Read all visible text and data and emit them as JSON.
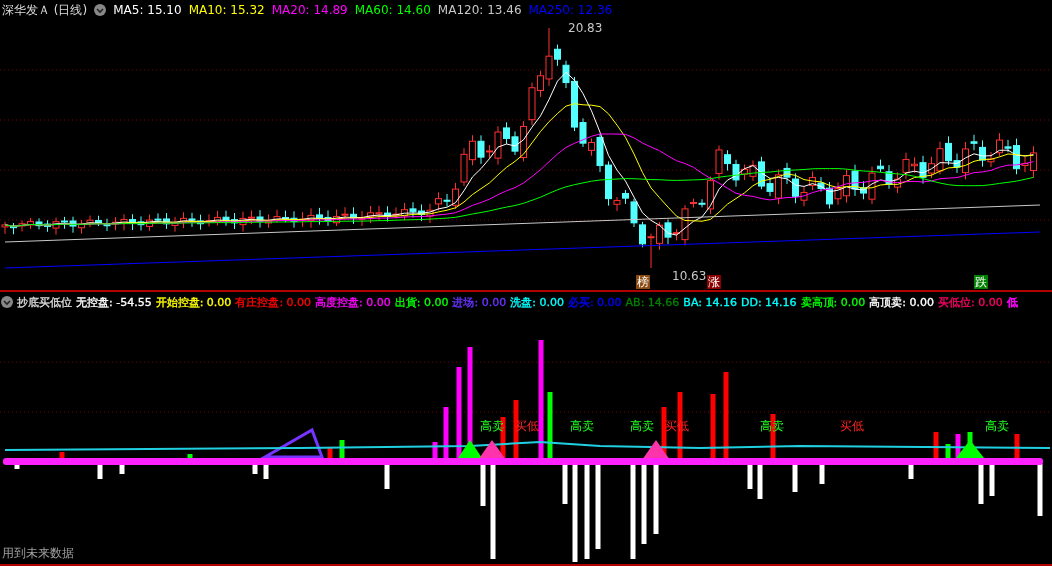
{
  "chart_title": "深华发Ａ (日线)",
  "ma_legend": [
    {
      "label": "MA5:",
      "value": "15.10",
      "color": "#ffffff"
    },
    {
      "label": "MA10:",
      "value": "15.32",
      "color": "#ffff00"
    },
    {
      "label": "MA20:",
      "value": "14.89",
      "color": "#ff00ff"
    },
    {
      "label": "MA60:",
      "value": "14.60",
      "color": "#00ff00"
    },
    {
      "label": "MA120:",
      "value": "13.46",
      "color": "#c8c8c8"
    },
    {
      "label": "MA250:",
      "value": "12.36",
      "color": "#0000ff"
    }
  ],
  "price_labels": [
    {
      "kind": "high",
      "text": "20.83"
    },
    {
      "kind": "low",
      "text": "10.63"
    }
  ],
  "badges": [
    {
      "text": "榜",
      "color": "#8b4a10"
    },
    {
      "text": "涨",
      "color": "#8b0000"
    },
    {
      "text": "跌",
      "color": "#008000"
    }
  ],
  "indicator": {
    "title": "抄底买低位",
    "legend": [
      {
        "label": "无控盘:",
        "value": "-54.55",
        "color": "#ffffff"
      },
      {
        "label": "开始控盘:",
        "value": "0.00",
        "color": "#ffff00"
      },
      {
        "label": "有庄控盘:",
        "value": "0.00",
        "color": "#ff0000"
      },
      {
        "label": "高度控盘:",
        "value": "0.00",
        "color": "#ff00ff"
      },
      {
        "label": "出貨:",
        "value": "0.00",
        "color": "#00ff00"
      },
      {
        "label": "进场:",
        "value": "0.00",
        "color": "#6633ff"
      },
      {
        "label": "洗盘:",
        "value": "0.00",
        "color": "#00ffff"
      },
      {
        "label": "必买:",
        "value": "0.00",
        "color": "#0000ff"
      },
      {
        "label": "AB:",
        "value": "14.66",
        "color": "#008000"
      },
      {
        "label": "BA:",
        "value": "14.16",
        "color": "#00ffff"
      },
      {
        "label": "DD:",
        "value": "14.16",
        "color": "#00ffff"
      },
      {
        "label": "卖高顶:",
        "value": "0.00",
        "color": "#00ff00"
      },
      {
        "label": "高顶卖:",
        "value": "0.00",
        "color": "#ffffff"
      },
      {
        "label": "买低位:",
        "value": "0.00",
        "color": "#ff0066"
      },
      {
        "label": "低",
        "color": "#ff00ff"
      }
    ],
    "signals": [
      {
        "kind": "sell",
        "text": "高卖"
      },
      {
        "kind": "buy",
        "text": "买低"
      },
      {
        "kind": "sell",
        "text": "高卖"
      },
      {
        "kind": "sell",
        "text": "高卖"
      },
      {
        "kind": "buy",
        "text": "买低"
      },
      {
        "kind": "sell",
        "text": "高卖"
      },
      {
        "kind": "buy",
        "text": "买低"
      },
      {
        "kind": "sell",
        "text": "高卖"
      }
    ]
  },
  "footer_note": "用到未来数据"
}
